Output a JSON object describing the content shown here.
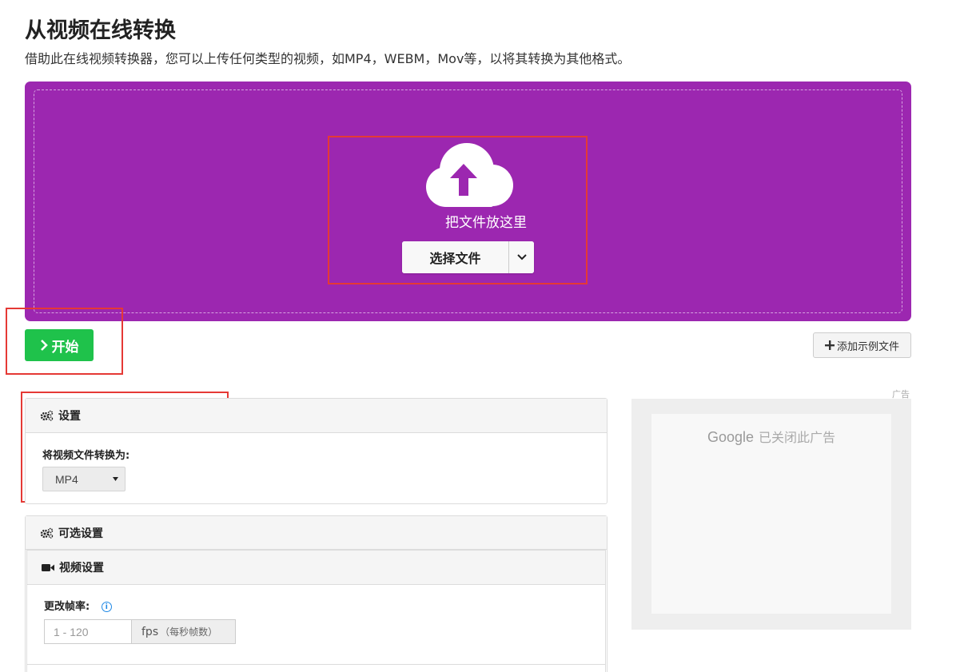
{
  "header": {
    "title": "从视频在线转换",
    "subtitle": "借助此在线视频转换器，您可以上传任何类型的视频，如MP4，WEBM，Mov等，以将其转换为其他格式。"
  },
  "upload": {
    "drop_text": "把文件放这里",
    "choose_label": "选择文件",
    "icons": [
      "cloud-upload-icon",
      "chevron-down-icon"
    ],
    "colors": {
      "drop_zone": "#9c27b0"
    }
  },
  "actions": {
    "start_label": "开始",
    "add_sample_label": "添加示例文件",
    "colors": {
      "start": "#1fc24b"
    }
  },
  "settings": {
    "title": "设置",
    "convert_label": "将视频文件转换为:",
    "format_value": "MP4"
  },
  "optional": {
    "title": "可选设置",
    "video": {
      "title": "视频设置",
      "fps_label": "更改帧率:",
      "fps_placeholder": "1 - 120",
      "fps_unit": "fps",
      "fps_unit_note": "（每秒帧数）"
    }
  },
  "ad": {
    "label": "广告",
    "google": "Google",
    "closed_text": "已关闭此广告"
  }
}
